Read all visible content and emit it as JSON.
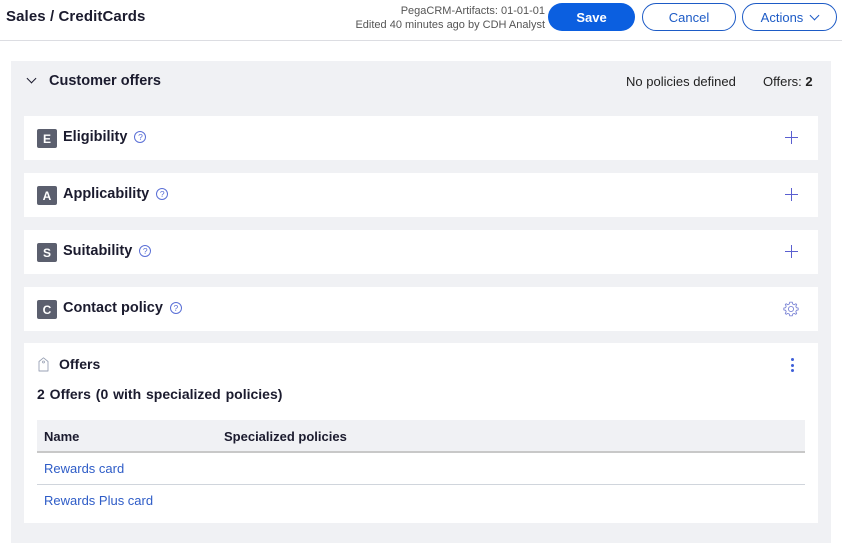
{
  "header": {
    "title": "Sales / CreditCards",
    "ruleset": "PegaCRM-Artifacts: 01-01-01",
    "edited": "Edited 40 minutes ago by CDH Analyst",
    "save_label": "Save",
    "cancel_label": "Cancel",
    "actions_label": "Actions"
  },
  "section": {
    "title": "Customer offers",
    "policies_status": "No policies defined",
    "offers_label": "Offers:",
    "offers_count": "2"
  },
  "policies": [
    {
      "badge": "E",
      "label": "Eligibility",
      "help": "?",
      "action_icon": "plus-icon"
    },
    {
      "badge": "A",
      "label": "Applicability",
      "help": "?",
      "action_icon": "plus-icon"
    },
    {
      "badge": "S",
      "label": "Suitability",
      "help": "?",
      "action_icon": "plus-icon"
    },
    {
      "badge": "C",
      "label": "Contact policy",
      "help": "?",
      "action_icon": "gear-icon"
    }
  ],
  "offers": {
    "title": "Offers",
    "summary": "2 Offers (0 with specialized policies)",
    "columns": [
      "Name",
      "Specialized policies"
    ],
    "rows": [
      {
        "name": "Rewards card",
        "specialized_policies": ""
      },
      {
        "name": "Rewards Plus card",
        "specialized_policies": ""
      }
    ]
  },
  "colors": {
    "primary": "#0b5fe0",
    "link": "#2e5cc7",
    "section_bg": "#f0f1f4",
    "badge_bg": "#5b5f6e"
  }
}
